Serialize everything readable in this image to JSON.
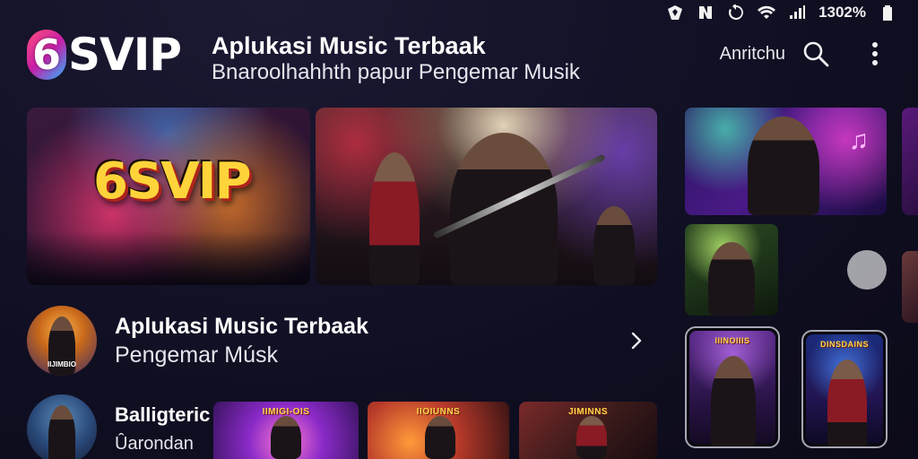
{
  "status_bar": {
    "time": "1302%"
  },
  "header": {
    "logo_digit": "6",
    "logo_word": "SVIP",
    "title": "Aplukasi Music Terbaak",
    "subtitle": "Bnaroolhahhth papur Pengemar Musik",
    "action_label": "Anritchu"
  },
  "banners": {
    "logo_text": "6SVIP"
  },
  "list": [
    {
      "title": "Aplukasi Music Terbaak",
      "subtitle": "Pengemar Músk",
      "avatar_caption": "IIJIMBIO"
    },
    {
      "title": "Balligteric",
      "subtitle": "Ûarondan",
      "avatar_caption": ""
    }
  ],
  "thumbnails": [
    {
      "title": "IIMIGI-OIS"
    },
    {
      "title": "IIOIUNNS"
    },
    {
      "title": "JIMINNS"
    }
  ],
  "phones": [
    {
      "title": "IIINOIIIS"
    },
    {
      "title": "DINSDAINS"
    }
  ],
  "icons": [
    "signal-icon",
    "nfc-icon",
    "rotate-icon",
    "wifi-icon",
    "cell-signal-icon",
    "battery-icon",
    "search-icon",
    "more-vertical-icon",
    "chevron-right-icon",
    "music-note-icon"
  ]
}
